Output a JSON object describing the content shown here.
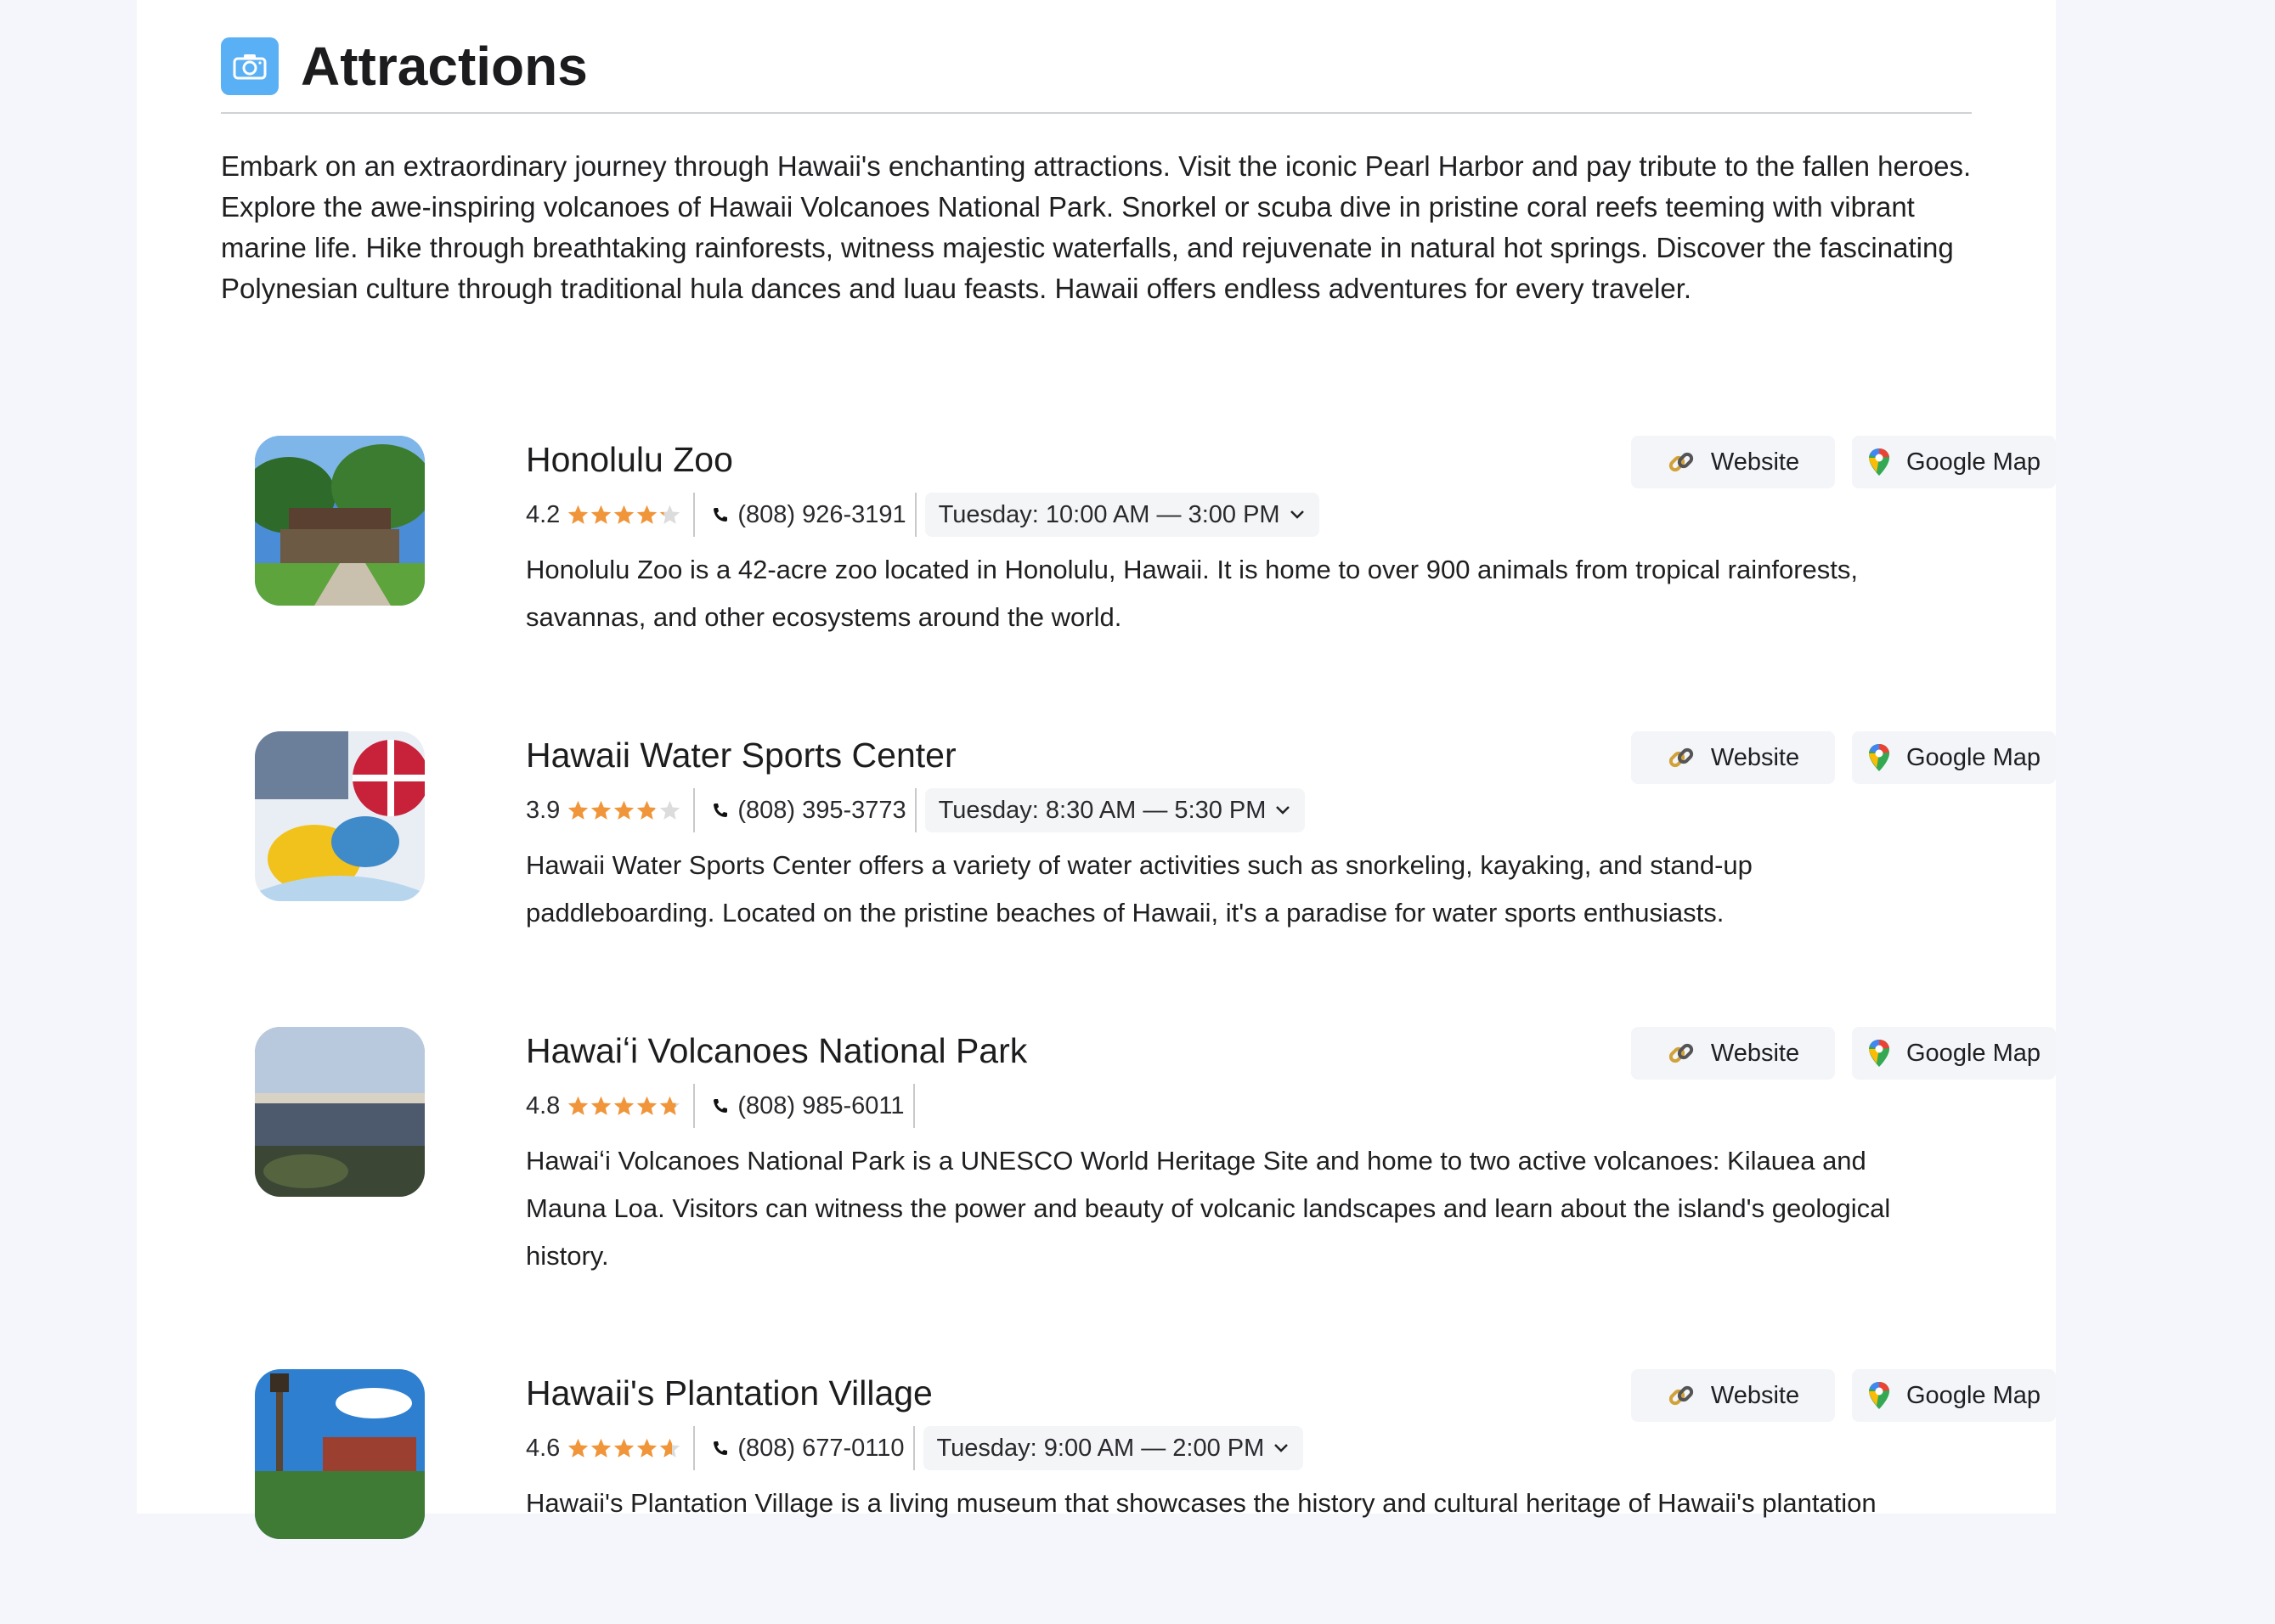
{
  "section": {
    "title": "Attractions",
    "intro": "Embark on an extraordinary journey through Hawaii's enchanting attractions. Visit the iconic Pearl Harbor and pay tribute to the fallen heroes. Explore the awe-inspiring volcanoes of Hawaii Volcanoes National Park. Snorkel or scuba dive in pristine coral reefs teeming with vibrant marine life. Hike through breathtaking rainforests, witness majestic waterfalls, and rejuvenate in natural hot springs. Discover the fascinating Polynesian culture through traditional hula dances and luau feasts. Hawaii offers endless adventures for every traveler.",
    "icon": "camera-icon",
    "accent": "#5ab0f4"
  },
  "buttons": {
    "website": "Website",
    "map": "Google Map"
  },
  "colors": {
    "star": "#f0953a",
    "star_empty": "#dcdcdc"
  },
  "items": [
    {
      "name": "Honolulu Zoo",
      "rating": "4.2",
      "rating_value": 4.2,
      "phone": "(808) 926-3191",
      "hours": "Tuesday: 10:00 AM — 3:00 PM",
      "description": "Honolulu Zoo is a 42-acre zoo located in Honolulu, Hawaii. It is home to over 900 animals from tropical rainforests, savannas, and other ecosystems around the world."
    },
    {
      "name": "Hawaii Water Sports Center",
      "rating": "3.9",
      "rating_value": 3.9,
      "phone": "(808) 395-3773",
      "hours": "Tuesday: 8:30 AM — 5:30 PM",
      "description": "Hawaii Water Sports Center offers a variety of water activities such as snorkeling, kayaking, and stand-up paddleboarding. Located on the pristine beaches of Hawaii, it's a paradise for water sports enthusiasts."
    },
    {
      "name": "Hawaiʻi Volcanoes National Park",
      "rating": "4.8",
      "rating_value": 4.8,
      "phone": "(808) 985-6011",
      "hours": "",
      "description": "Hawaiʻi Volcanoes National Park is a UNESCO World Heritage Site and home to two active volcanoes: Kilauea and Mauna Loa. Visitors can witness the power and beauty of volcanic landscapes and learn about the island's geological history."
    },
    {
      "name": "Hawaii's Plantation Village",
      "rating": "4.6",
      "rating_value": 4.6,
      "phone": "(808) 677-0110",
      "hours": "Tuesday: 9:00 AM — 2:00 PM",
      "description": "Hawaii's Plantation Village is a living museum that showcases the history and cultural heritage of Hawaii's plantation"
    }
  ]
}
